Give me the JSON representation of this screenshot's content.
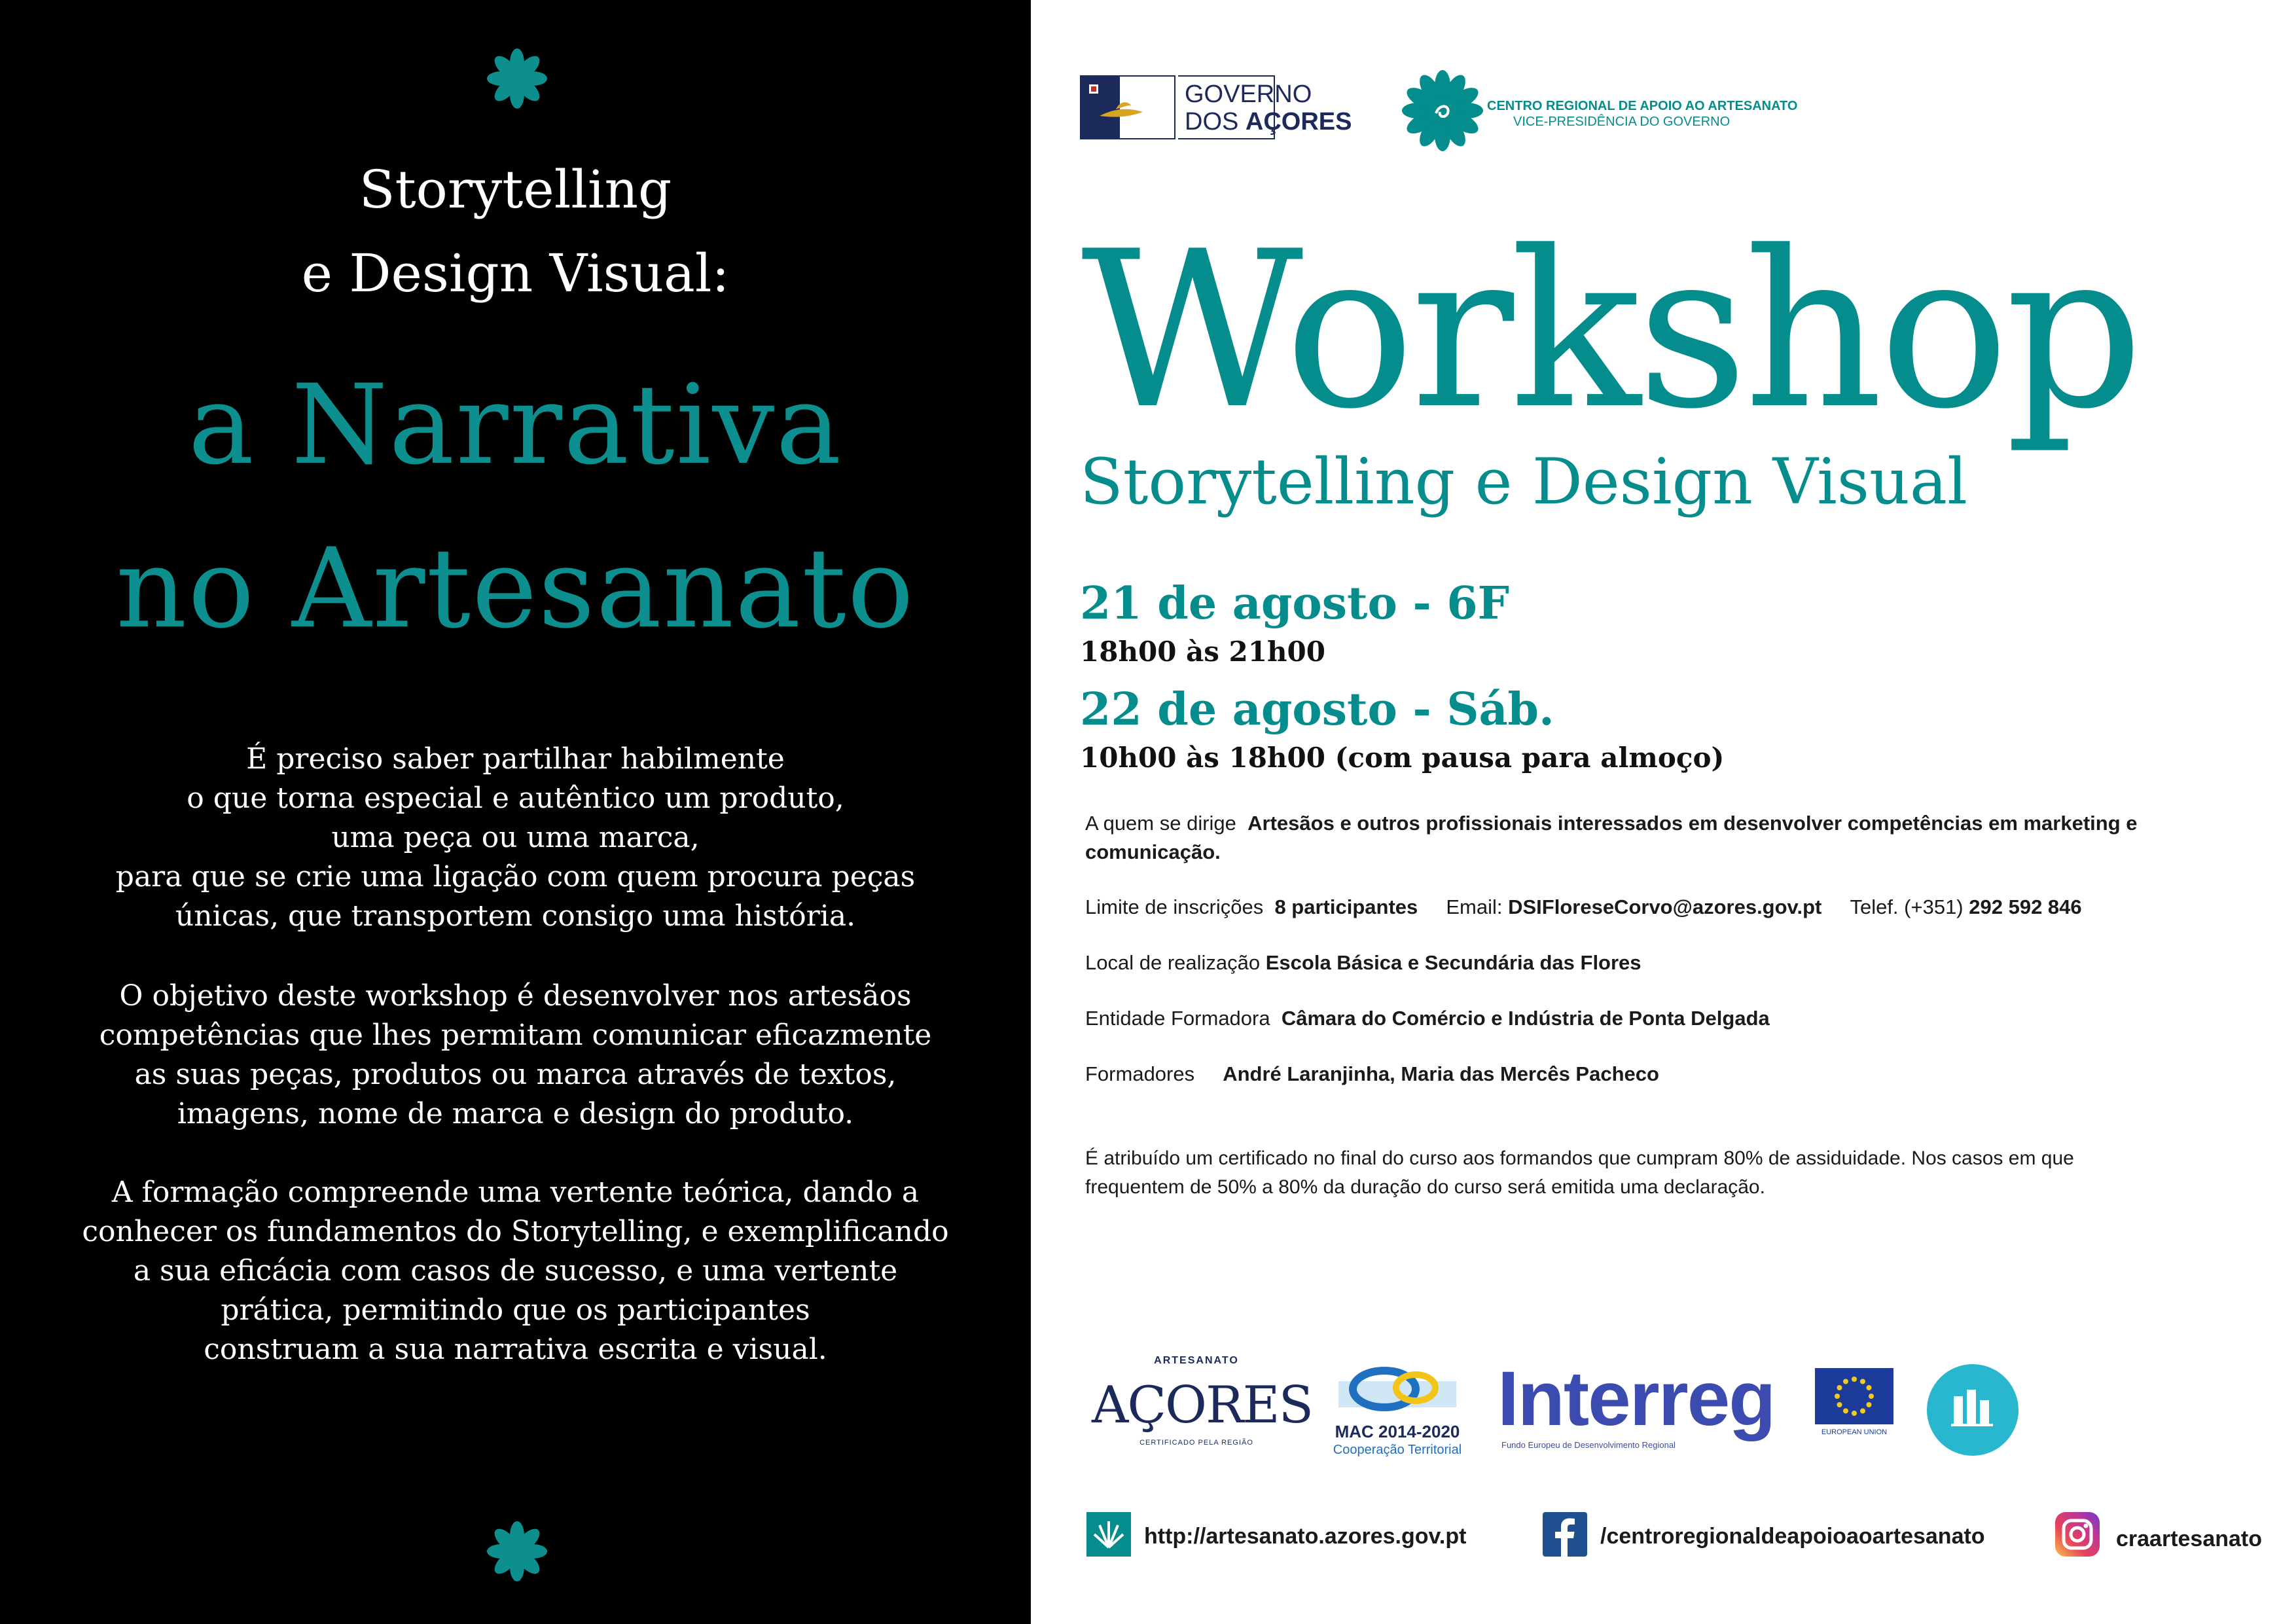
{
  "left": {
    "title_line1": "Storytelling",
    "title_line2": "e Design Visual:",
    "big_line1": "a Narrativa",
    "big_line2": "no Artesanato",
    "para1": [
      "É preciso saber partilhar habilmente",
      "o que torna especial e autêntico um produto,",
      "uma peça ou uma marca,",
      "para que se crie uma ligação com quem procura peças",
      "únicas, que transportem consigo uma história."
    ],
    "para2": [
      "O objetivo deste workshop é desenvolver nos artesãos",
      "competências que lhes permitam comunicar eficazmente",
      "as suas peças, produtos ou marca através de textos,",
      "imagens, nome de marca e design do produto."
    ],
    "para3": [
      "A formação compreende uma vertente teórica, dando a",
      "conhecer os fundamentos do Storytelling, e exemplificando",
      "a sua eficácia com casos de sucesso, e uma vertente",
      "prática, permitindo que os participantes",
      "construam a sua narrativa escrita e visual."
    ]
  },
  "header": {
    "gov_line1": "GOVERNO",
    "gov_line2_a": "DOS ",
    "gov_line2_b": "AÇORES",
    "cra_line1": "CENTRO REGIONAL DE APOIO AO ARTESANATO",
    "cra_line2": "VICE-PRESIDÊNCIA DO GOVERNO"
  },
  "main": {
    "title": "Workshop",
    "subtitle": "Storytelling e Design Visual",
    "date1": "21 de agosto - 6F",
    "time1": "18h00 às 21h00",
    "date2": "22 de agosto - Sáb.",
    "time2": "10h00 às 18h00 (com pausa para almoço)"
  },
  "info": {
    "audience_label": "A quem se dirige",
    "audience_value_1": "Artesãos e outros profissionais interessados em desenvolver competências em marketing e",
    "audience_value_2": "comunicação.",
    "limit_label": "Limite de inscrições",
    "limit_value": "8 participantes",
    "email_label": "Email:",
    "email_value": "DSIFloreseCorvo@azores.gov.pt",
    "phone_label": "Telef. (+351)",
    "phone_value": "292 592 846",
    "location_label": "Local de realização",
    "location_value": "Escola Básica e Secundária das Flores",
    "entity_label": "Entidade Formadora",
    "entity_value": "Câmara do Comércio e Indústria de Ponta Delgada",
    "trainers_label": "Formadores",
    "trainers_value": "André Laranjinha, Maria das Mercês Pacheco",
    "certificate_1": "É atribuído um certificado no final do curso aos formandos que cumpram 80% de assiduidade. Nos casos em que",
    "certificate_2": "frequentem de 50% a 80% da duração do curso será emitida uma declaração."
  },
  "logos": {
    "artesanato_top": "ARTESANATO",
    "artesanato_main": "AÇORES",
    "artesanato_bottom": "CERTIFICADO PELA REGIÃO",
    "mac_line1": "MAC 2014-2020",
    "mac_line2": "Cooperação Territorial",
    "interreg": "Interreg",
    "interreg_sub": "Fundo Europeu de Desenvolvimento Regional",
    "eu": "EUROPEAN UNION"
  },
  "footer": {
    "website": "http://artesanato.azores.gov.pt",
    "facebook": "/centroregionaldeapoioaoartesanato",
    "instagram": "craartesanato"
  },
  "colors": {
    "teal": "#058c8c",
    "black": "#000000",
    "navy": "#1b2a5a",
    "interreg_blue": "#3b4bb0",
    "facebook_blue": "#1f4f8f"
  }
}
